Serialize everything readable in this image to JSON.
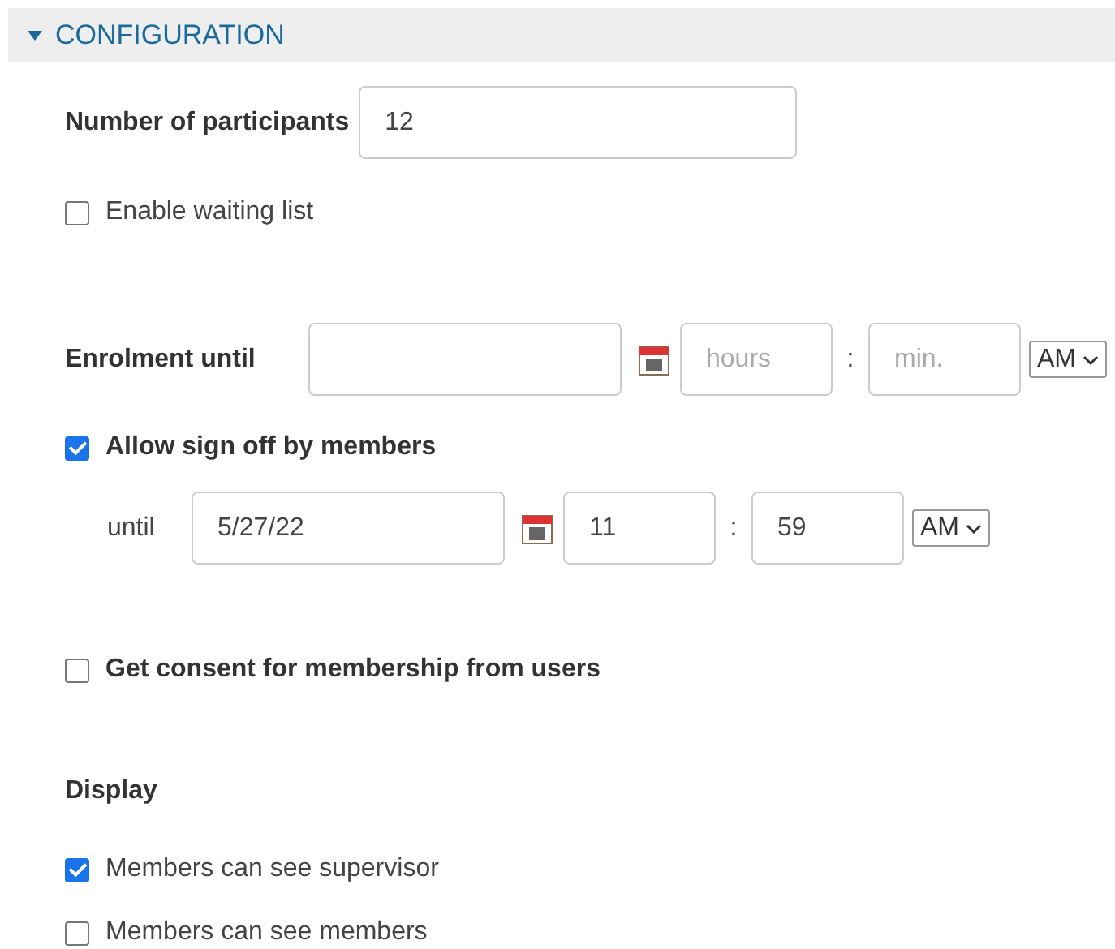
{
  "section": {
    "title": "CONFIGURATION",
    "expanded": true
  },
  "participants": {
    "label": "Number of participants",
    "value": "12"
  },
  "waiting_list": {
    "label": "Enable waiting list",
    "checked": false
  },
  "enrolment": {
    "label": "Enrolment until",
    "hours_placeholder": "hours",
    "separator": ":",
    "minutes_placeholder": "min.",
    "period": "AM"
  },
  "sign_off": {
    "label": "Allow sign off by members",
    "checked": true,
    "until": {
      "label": "until",
      "date": "5/27/22",
      "hours": "11",
      "separator": ":",
      "minutes": "59",
      "period": "AM"
    }
  },
  "consent": {
    "label": "Get consent for membership from users",
    "checked": false
  },
  "display": {
    "heading": "Display",
    "options": [
      {
        "label": "Members can see supervisor",
        "checked": true
      },
      {
        "label": "Members can see members",
        "checked": false
      }
    ]
  }
}
